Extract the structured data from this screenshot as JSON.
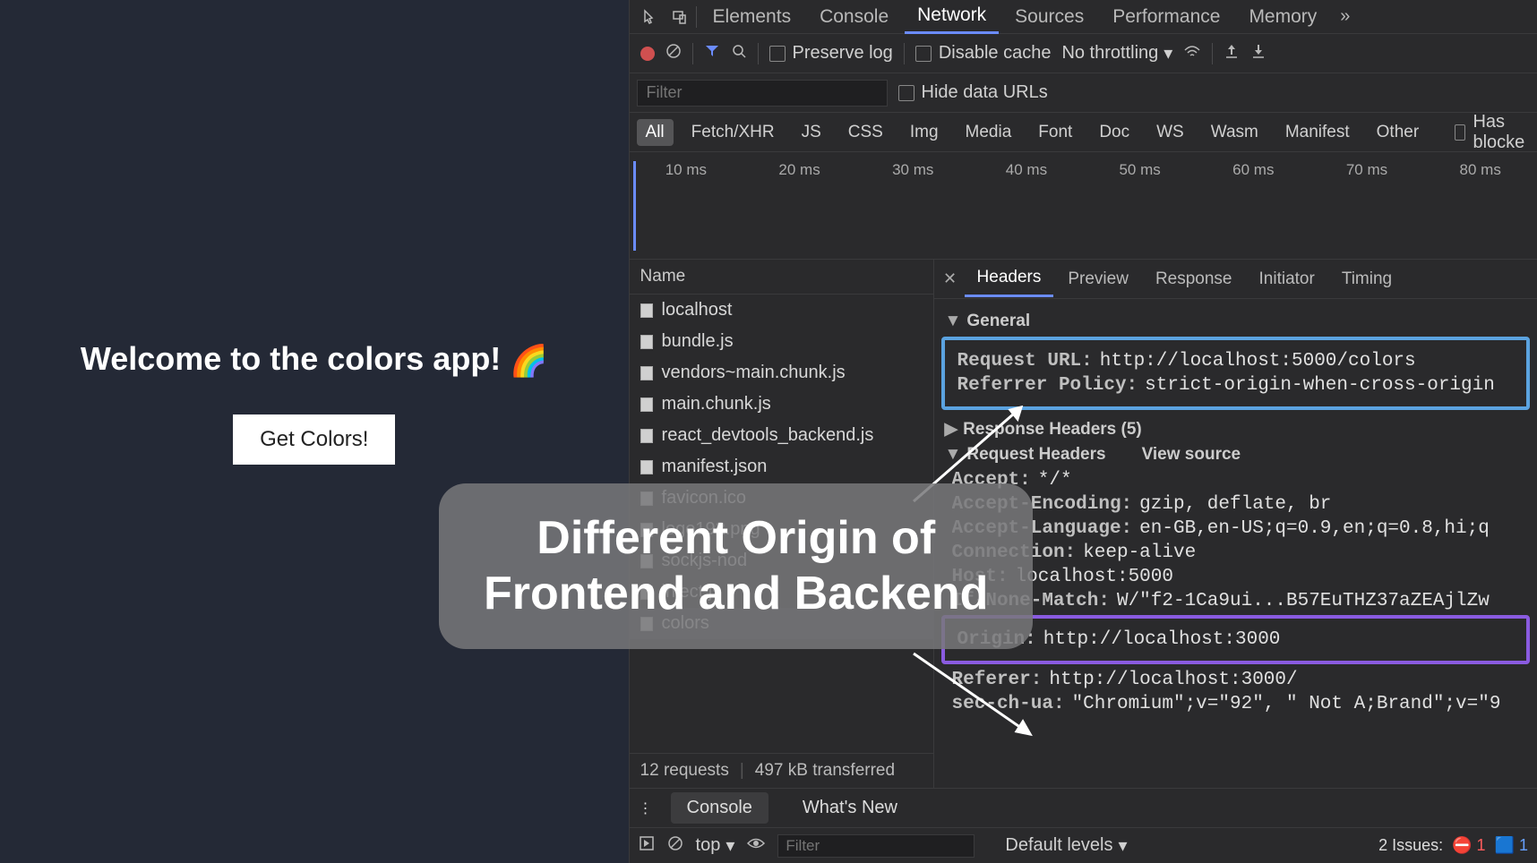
{
  "app": {
    "welcome_prefix": "Welcome to the ",
    "welcome_strong": "colors app!",
    "rainbow": "🌈",
    "button": "Get Colors!"
  },
  "devtools": {
    "tabs": [
      "Elements",
      "Console",
      "Network",
      "Sources",
      "Performance",
      "Memory"
    ],
    "active_tab": "Network",
    "overflow": "»",
    "preserve_log": "Preserve log",
    "disable_cache": "Disable cache",
    "throttle": "No throttling",
    "filter_placeholder": "Filter",
    "hide_data_urls": "Hide data URLs",
    "types": [
      "All",
      "Fetch/XHR",
      "JS",
      "CSS",
      "Img",
      "Media",
      "Font",
      "Doc",
      "WS",
      "Wasm",
      "Manifest",
      "Other"
    ],
    "has_blocked": "Has blocke",
    "ticks": [
      "10 ms",
      "20 ms",
      "30 ms",
      "40 ms",
      "50 ms",
      "60 ms",
      "70 ms",
      "80 ms"
    ],
    "name_header": "Name",
    "requests": [
      "localhost",
      "bundle.js",
      "vendors~main.chunk.js",
      "main.chunk.js",
      "react_devtools_backend.js",
      "manifest.json",
      "favicon.ico",
      "logo192.png",
      "sockjs-nod",
      "inject.js",
      "colors"
    ],
    "selected_request": "colors",
    "req_count": "12 requests",
    "req_size": "497 kB transferred",
    "detail_tabs": [
      "Headers",
      "Preview",
      "Response",
      "Initiator",
      "Timing"
    ],
    "detail_active": "Headers",
    "general_label": "General",
    "general": {
      "request_url_k": "Request URL:",
      "request_url_v": "http://localhost:5000/colors",
      "referrer_policy_k": "Referrer Policy:",
      "referrer_policy_v": "strict-origin-when-cross-origin"
    },
    "response_headers_label": "Response Headers (5)",
    "request_headers_label": "Request Headers",
    "view_source": "View source",
    "req_headers": {
      "accept_k": "Accept:",
      "accept_v": "*/*",
      "accept_encoding_k": "Accept-Encoding:",
      "accept_encoding_v": "gzip, deflate, br",
      "accept_language_k": "Accept-Language:",
      "accept_language_v": "en-GB,en-US;q=0.9,en;q=0.8,hi;q",
      "connection_k": "Connection:",
      "connection_v": "keep-alive",
      "host_k": "Host:",
      "host_v": "localhost:5000",
      "if_none_match_k": "If-None-Match:",
      "if_none_match_v": "W/\"f2-1Ca9ui...B57EuTHZ37aZEAjlZw",
      "origin_k": "Origin:",
      "origin_v": "http://localhost:3000",
      "referer_k": "Referer:",
      "referer_v": "http://localhost:3000/",
      "sec_ch_ua_k": "sec-ch-ua:",
      "sec_ch_ua_v": "\"Chromium\";v=\"92\", \" Not A;Brand\";v=\"9"
    },
    "dock_tabs": [
      "Console",
      "What's New"
    ],
    "console": {
      "context": "top",
      "filter_placeholder": "Filter",
      "levels": "Default levels",
      "issues_label": "2 Issues:",
      "issue_red": "1",
      "issue_blue": "1"
    }
  },
  "callout": {
    "line1": "Different Origin of",
    "line2": "Frontend and Backend"
  }
}
